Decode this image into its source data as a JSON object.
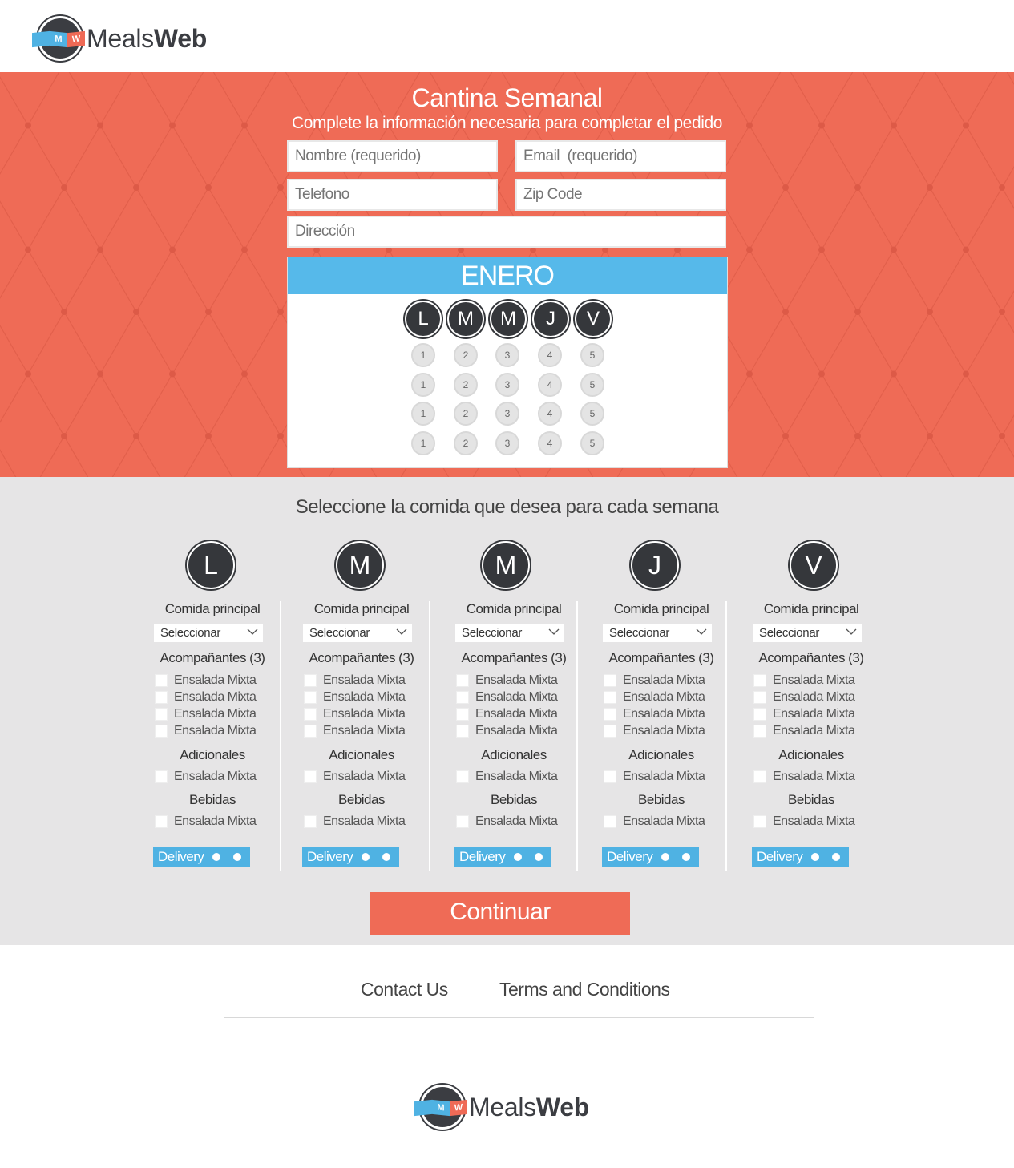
{
  "header": {
    "logo": {
      "badge_text": [
        "M",
        "W"
      ],
      "word_light": "Meals",
      "word_bold": "Web"
    }
  },
  "hero": {
    "title": "Cantina Semanal",
    "subtitle": "Complete la información necesaria para completar el pedido",
    "fields": {
      "name_placeholder": "Nombre (requerido)",
      "email_placeholder": "Email  (requerido)",
      "phone_placeholder": "Telefono",
      "zip_placeholder": "Zip Code",
      "address_placeholder": "Dirección"
    },
    "calendar": {
      "month": "ENERO",
      "days": [
        "L",
        "M",
        "M",
        "J",
        "V"
      ],
      "weeks": [
        [
          "1",
          "2",
          "3",
          "4",
          "5"
        ],
        [
          "1",
          "2",
          "3",
          "4",
          "5"
        ],
        [
          "1",
          "2",
          "3",
          "4",
          "5"
        ],
        [
          "1",
          "2",
          "3",
          "4",
          "5"
        ]
      ]
    }
  },
  "selection": {
    "title": "Seleccione la comida que desea para cada semana",
    "days": [
      {
        "day": "L",
        "main_label": "Comida principal",
        "select_value": "Seleccionar",
        "sides_label": "Acompañantes (3)",
        "sides": [
          "Ensalada Mixta",
          "Ensalada Mixta",
          "Ensalada Mixta",
          "Ensalada Mixta"
        ],
        "extras_label": "Adicionales",
        "extras": [
          "Ensalada Mixta"
        ],
        "drinks_label": "Bebidas",
        "drinks": [
          "Ensalada Mixta"
        ],
        "delivery_label": "Delivery"
      },
      {
        "day": "M",
        "main_label": "Comida principal",
        "select_value": "Seleccionar",
        "sides_label": "Acompañantes (3)",
        "sides": [
          "Ensalada Mixta",
          "Ensalada Mixta",
          "Ensalada Mixta",
          "Ensalada Mixta"
        ],
        "extras_label": "Adicionales",
        "extras": [
          "Ensalada Mixta"
        ],
        "drinks_label": "Bebidas",
        "drinks": [
          "Ensalada Mixta"
        ],
        "delivery_label": "Delivery"
      },
      {
        "day": "M",
        "main_label": "Comida principal",
        "select_value": "Seleccionar",
        "sides_label": "Acompañantes (3)",
        "sides": [
          "Ensalada Mixta",
          "Ensalada Mixta",
          "Ensalada Mixta",
          "Ensalada Mixta"
        ],
        "extras_label": "Adicionales",
        "extras": [
          "Ensalada Mixta"
        ],
        "drinks_label": "Bebidas",
        "drinks": [
          "Ensalada Mixta"
        ],
        "delivery_label": "Delivery"
      },
      {
        "day": "J",
        "main_label": "Comida principal",
        "select_value": "Seleccionar",
        "sides_label": "Acompañantes (3)",
        "sides": [
          "Ensalada Mixta",
          "Ensalada Mixta",
          "Ensalada Mixta",
          "Ensalada Mixta"
        ],
        "extras_label": "Adicionales",
        "extras": [
          "Ensalada Mixta"
        ],
        "drinks_label": "Bebidas",
        "drinks": [
          "Ensalada Mixta"
        ],
        "delivery_label": "Delivery"
      },
      {
        "day": "V",
        "main_label": "Comida principal",
        "select_value": "Seleccionar",
        "sides_label": "Acompañantes (3)",
        "sides": [
          "Ensalada Mixta",
          "Ensalada Mixta",
          "Ensalada Mixta",
          "Ensalada Mixta"
        ],
        "extras_label": "Adicionales",
        "extras": [
          "Ensalada Mixta"
        ],
        "drinks_label": "Bebidas",
        "drinks": [
          "Ensalada Mixta"
        ],
        "delivery_label": "Delivery"
      }
    ],
    "continue_label": "Continuar"
  },
  "footer": {
    "contact_label": "Contact Us",
    "terms_label": "Terms and Conditions",
    "logo": {
      "badge_text": [
        "M",
        "W"
      ],
      "word_light": "Meals",
      "word_bold": "Web"
    }
  },
  "colors": {
    "coral": "#ef6b56",
    "sky": "#56b9ea",
    "charcoal": "#35373b",
    "panel_gray": "#e6e5e6"
  }
}
